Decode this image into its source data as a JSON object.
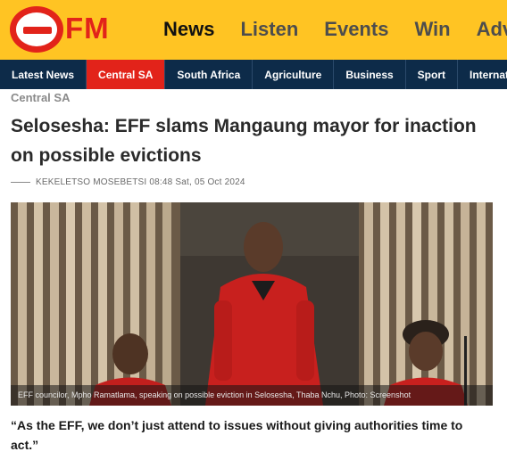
{
  "brand": {
    "logo_text": "FM",
    "accent": "#e2231a",
    "header_bg": "#ffc423",
    "nav_bg": "#0d2b49"
  },
  "main_nav": [
    {
      "label": "News",
      "active": true
    },
    {
      "label": "Listen",
      "active": false
    },
    {
      "label": "Events",
      "active": false
    },
    {
      "label": "Win",
      "active": false
    },
    {
      "label": "Adv",
      "active": false
    }
  ],
  "sub_nav": [
    {
      "label": "Latest News",
      "active": false
    },
    {
      "label": "Central SA",
      "active": true
    },
    {
      "label": "South Africa",
      "active": false
    },
    {
      "label": "Agriculture",
      "active": false
    },
    {
      "label": "Business",
      "active": false
    },
    {
      "label": "Sport",
      "active": false
    },
    {
      "label": "Internat",
      "active": false
    }
  ],
  "article": {
    "section": "Central SA",
    "headline": "Selosesha: EFF slams Mangaung mayor for inaction on possible evictions",
    "byline": "KEKELETSO MOSEBETSI 08:48 Sat, 05 Oct 2024",
    "photo_caption": "EFF councilor, Mpho Ramatlama, speaking on possible eviction in Selosesha, Thaba Nchu, Photo: Screenshot",
    "quote": "“As the EFF, we don’t just attend to issues without giving authorities time to act.”"
  }
}
